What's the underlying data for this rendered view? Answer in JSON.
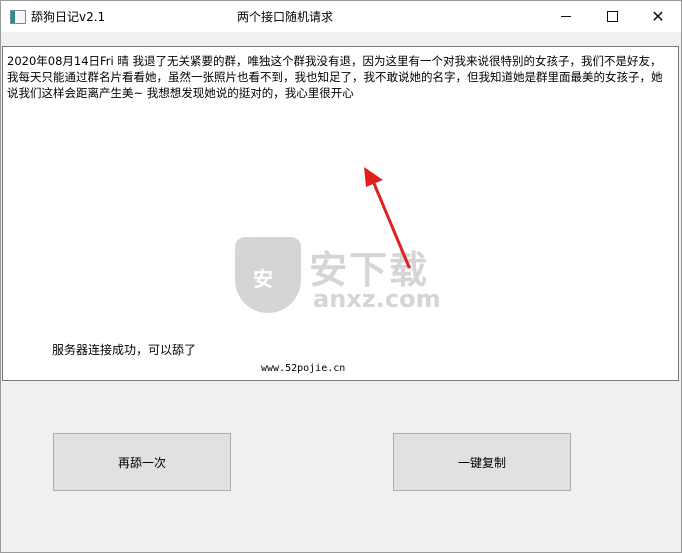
{
  "window": {
    "title": "舔狗日记v2.1",
    "subtitle": "两个接口随机请求",
    "minimize_icon": "minimize-icon",
    "maximize_icon": "maximize-icon",
    "close_icon": "close-icon",
    "close_glyph": "✕"
  },
  "content": {
    "diary_text": "2020年08月14日Fri 晴 我退了无关紧要的群，唯独这个群我没有退，因为这里有一个对我来说很特别的女孩子，我们不是好友，我每天只能通过群名片看看她，虽然一张照片也看不到，我也知足了，我不敢说她的名字，但我知道她是群里面最美的女孩子，她说我们这样会距离产生美~ 我想想发现她说的挺对的，我心里很开心",
    "status_text": "服务器连接成功，可以舔了",
    "site_text": "www.52pojie.cn"
  },
  "watermark": {
    "icon_char": "安",
    "cn": "安下载",
    "en": "anxz.com"
  },
  "buttons": {
    "again": "再舔一次",
    "copy": "一键复制"
  }
}
